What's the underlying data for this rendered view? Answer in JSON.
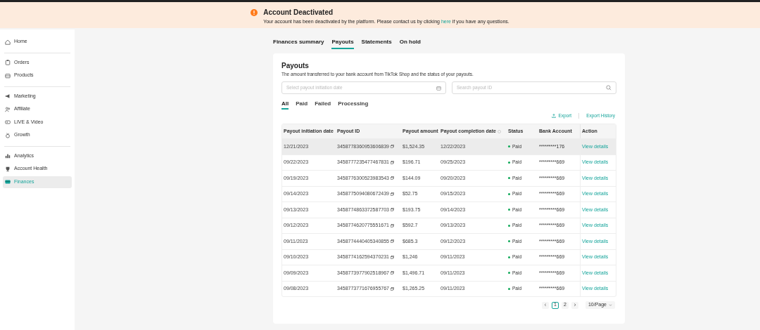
{
  "banner": {
    "title": "Account Deactivated",
    "message_before": "Your account has been deactivated by the platform. Please contact us by clicking",
    "link": "here",
    "message_after": "if you have any questions."
  },
  "sidebar": {
    "groups": [
      [
        {
          "label": "Home",
          "kind": "home",
          "selected": false
        }
      ],
      [
        {
          "label": "Orders",
          "kind": "orders",
          "selected": false
        },
        {
          "label": "Products",
          "kind": "products",
          "selected": false
        }
      ],
      [
        {
          "label": "Marketing",
          "kind": "marketing",
          "selected": false
        },
        {
          "label": "Affiliate",
          "kind": "affiliate",
          "selected": false
        },
        {
          "label": "LIVE & Video",
          "kind": "video",
          "selected": false
        },
        {
          "label": "Growth",
          "kind": "growth",
          "selected": false
        }
      ],
      [
        {
          "label": "Analytics",
          "kind": "analytics",
          "selected": false
        },
        {
          "label": "Account Health",
          "kind": "health",
          "selected": false
        },
        {
          "label": "Finances",
          "kind": "finances",
          "selected": true
        }
      ]
    ]
  },
  "tabs": [
    {
      "label": "Finances summary",
      "selected": false
    },
    {
      "label": "Payouts",
      "selected": true
    },
    {
      "label": "Statements",
      "selected": false
    },
    {
      "label": "On hold",
      "selected": false
    }
  ],
  "card": {
    "title": "Payouts",
    "description": "The amount transferred to your bank account from TikTok Shop and the status of your payouts.",
    "date_field": {
      "placeholder": "Select payout initiation date"
    },
    "search_field": {
      "placeholder": "Search payout ID"
    },
    "filters": [
      {
        "label": "All",
        "selected": true
      },
      {
        "label": "Paid",
        "selected": false
      },
      {
        "label": "Failed",
        "selected": false
      },
      {
        "label": "Processing",
        "selected": false
      }
    ],
    "export": "Export",
    "export_history": "Export History",
    "table": {
      "columns": [
        "Payout initiation date",
        "Payout ID",
        "Payout amount",
        "Payout completion date",
        "Status",
        "Bank Account",
        "Action"
      ],
      "rows": [
        {
          "initiation": "12/21/2023",
          "id": "3458778360953606839",
          "amount": "$1,524.35",
          "completion": "12/22/2023",
          "status": "Paid",
          "account": "*********176",
          "action": "View details",
          "selected": true
        },
        {
          "initiation": "09/22/2023",
          "id": "3458777235477467831",
          "amount": "$196.71",
          "completion": "09/25/2023",
          "status": "Paid",
          "account": "*********669",
          "action": "View details",
          "selected": false
        },
        {
          "initiation": "09/19/2023",
          "id": "3458776300523983543",
          "amount": "$144.09",
          "completion": "09/20/2023",
          "status": "Paid",
          "account": "*********669",
          "action": "View details",
          "selected": false
        },
        {
          "initiation": "09/14/2023",
          "id": "3458775094080672439",
          "amount": "$52.75",
          "completion": "09/15/2023",
          "status": "Paid",
          "account": "*********669",
          "action": "View details",
          "selected": false
        },
        {
          "initiation": "09/13/2023",
          "id": "3458774863372587703",
          "amount": "$193.75",
          "completion": "09/14/2023",
          "status": "Paid",
          "account": "*********669",
          "action": "View details",
          "selected": false
        },
        {
          "initiation": "09/12/2023",
          "id": "3458774620775551671",
          "amount": "$592.7",
          "completion": "09/13/2023",
          "status": "Paid",
          "account": "*********669",
          "action": "View details",
          "selected": false
        },
        {
          "initiation": "09/11/2023",
          "id": "3458774440405340855",
          "amount": "$685.3",
          "completion": "09/12/2023",
          "status": "Paid",
          "account": "*********669",
          "action": "View details",
          "selected": false
        },
        {
          "initiation": "09/10/2023",
          "id": "3458774162594370231",
          "amount": "$1,246",
          "completion": "09/11/2023",
          "status": "Paid",
          "account": "*********669",
          "action": "View details",
          "selected": false
        },
        {
          "initiation": "09/09/2023",
          "id": "3458773977902518967",
          "amount": "$1,496.71",
          "completion": "09/11/2023",
          "status": "Paid",
          "account": "*********669",
          "action": "View details",
          "selected": false
        },
        {
          "initiation": "09/08/2023",
          "id": "3458773771676955767",
          "amount": "$1,265.25",
          "completion": "09/11/2023",
          "status": "Paid",
          "account": "*********669",
          "action": "View details",
          "selected": false
        }
      ]
    },
    "pagination": {
      "prev": "‹",
      "pages": [
        {
          "label": "1",
          "selected": true
        },
        {
          "label": "2",
          "selected": false
        }
      ],
      "next": "›",
      "page_size": "10/Page"
    }
  }
}
